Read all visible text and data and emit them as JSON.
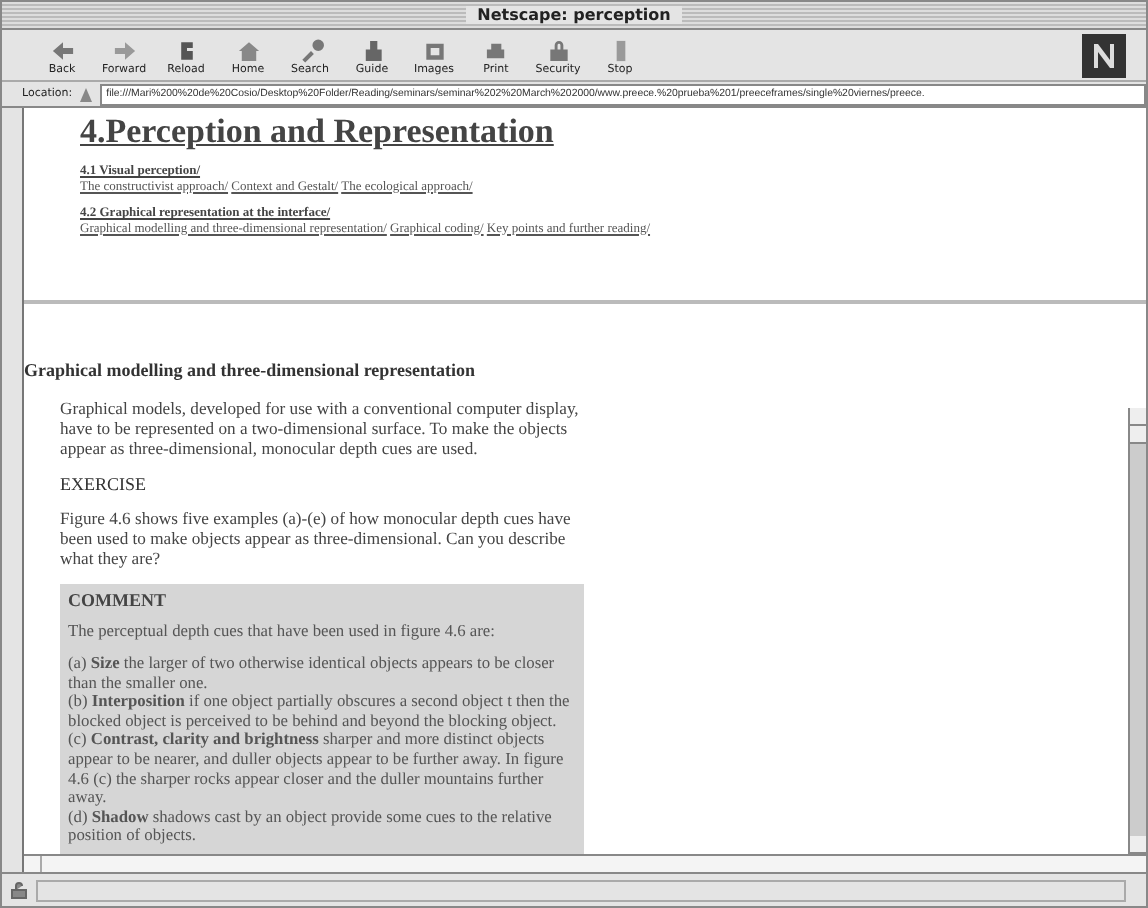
{
  "window": {
    "title": "Netscape: perception"
  },
  "toolbar": [
    {
      "label": "Back"
    },
    {
      "label": "Forward"
    },
    {
      "label": "Reload"
    },
    {
      "label": "Home"
    },
    {
      "label": "Search"
    },
    {
      "label": "Guide"
    },
    {
      "label": "Images"
    },
    {
      "label": "Print"
    },
    {
      "label": "Security"
    },
    {
      "label": "Stop"
    }
  ],
  "location": {
    "label": "Location:",
    "value": "file:///Mari%200%20de%20Cosio/Desktop%20Folder/Reading/seminars/seminar%202%20March%202000/www.preece.%20prueba%201/preeceframes/single%20viernes/preece."
  },
  "contents_frame": {
    "heading": "4.Perception and Representation",
    "sections": [
      {
        "title": "4.1 Visual perception/",
        "links": [
          "The constructivist approach/",
          "Context and Gestalt/",
          "The ecological approach/"
        ]
      },
      {
        "title": "4.2 Graphical representation at the interface/",
        "links": [
          "Graphical modelling and three-dimensional representation/",
          "Graphical coding/",
          "Key points and further reading/"
        ]
      }
    ]
  },
  "main_frame": {
    "heading": "Graphical modelling and three-dimensional representation",
    "intro": "Graphical models, developed for use with a conventional computer display, have to be represented on a two-dimensional surface. To make the objects appear as three-dimensional, monocular depth cues are used.",
    "exercise_title": "EXERCISE",
    "exercise_text": "Figure 4.6 shows five examples (a)-(e) of how monocular depth cues have been used to make objects appear as three-dimensional. Can you describe what they are?",
    "comment": {
      "title": "COMMENT",
      "lead": "The perceptual depth cues that have been used in figure 4.6 are:",
      "items": [
        "(a) **Size** the larger of two otherwise identical objects appears to be closer than the smaller one.",
        "(b) **Interposition** if one object partially obscures a second object t then the blocked object is perceived to be behind and beyond the blocking object.",
        "(c) **Contrast, clarity and brightness** sharper and more distinct objects appear to be nearer, and duller objects appear to be further away. In figure 4.6 (c) the sharper rocks appear closer and the duller mountains further away.",
        "(d) **Shadow** shadows cast by an object provide some cues to the relative position of objects."
      ]
    }
  }
}
